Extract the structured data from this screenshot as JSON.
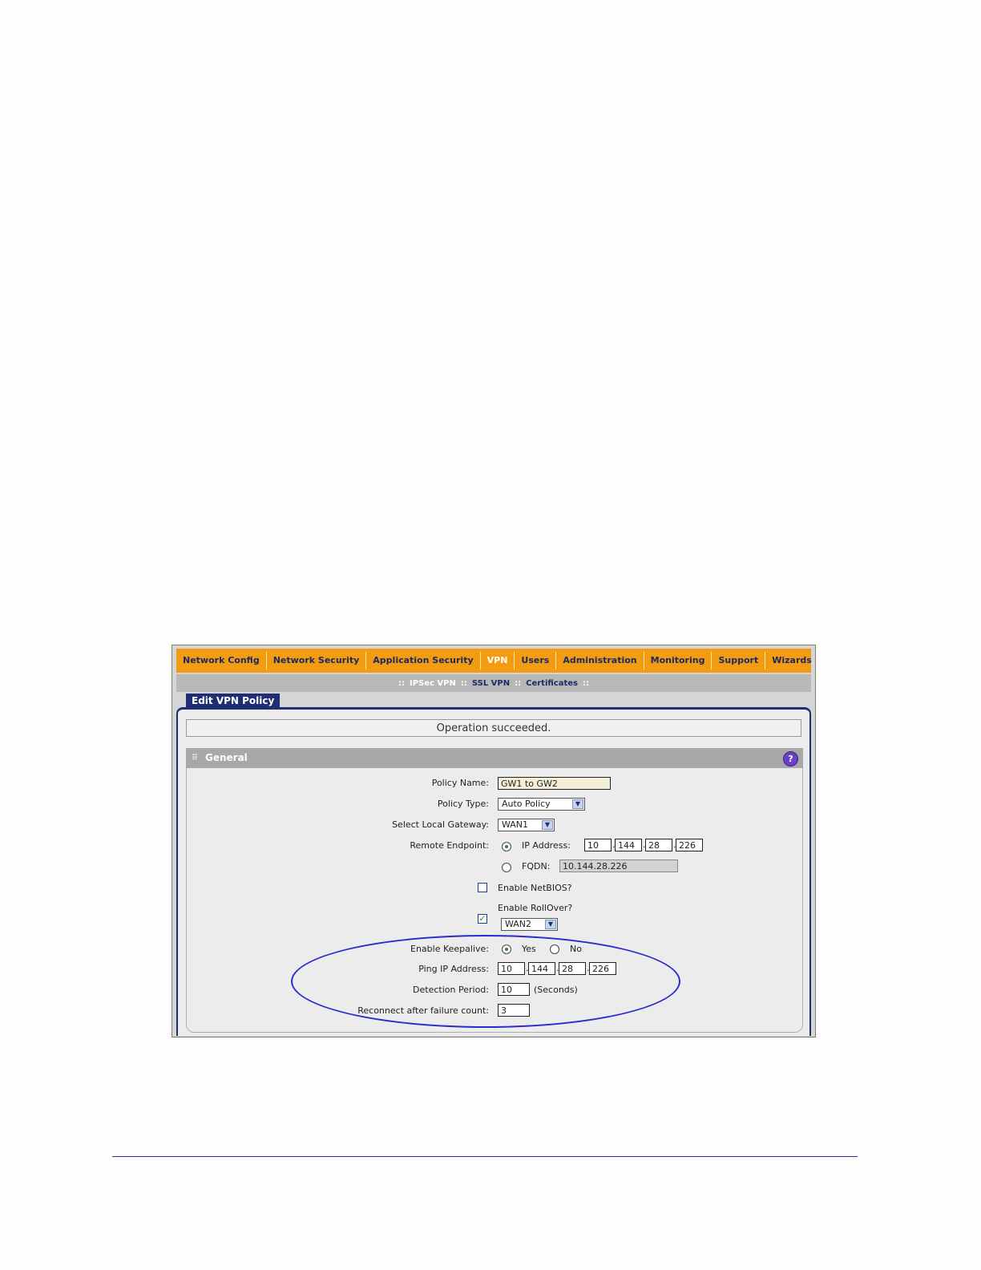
{
  "nav": {
    "items": [
      "Network Config",
      "Network Security",
      "Application Security",
      "VPN",
      "Users",
      "Administration",
      "Monitoring",
      "Support",
      "Wizards"
    ],
    "active": "VPN"
  },
  "subnav": {
    "sep": "::",
    "links": [
      "IPSec VPN",
      "SSL VPN",
      "Certificates"
    ]
  },
  "tab": {
    "label": "Edit VPN Policy"
  },
  "message": "Operation succeeded.",
  "section": {
    "title": "General",
    "grip": "⠿",
    "help": "?"
  },
  "form": {
    "policy_name": {
      "label": "Policy Name:",
      "value": "GW1 to GW2"
    },
    "policy_type": {
      "label": "Policy Type:",
      "value": "Auto Policy"
    },
    "local_gateway": {
      "label": "Select Local Gateway:",
      "value": "WAN1"
    },
    "remote_endpoint": {
      "label": "Remote Endpoint:",
      "ip_label": "IP Address:",
      "ip": [
        "10",
        "144",
        "28",
        "226"
      ],
      "fqdn_label": "FQDN:",
      "fqdn": "10.144.28.226"
    },
    "netbios": {
      "label": "Enable NetBIOS?",
      "checked": false
    },
    "rollover": {
      "label": "Enable RollOver?",
      "checked": true,
      "value": "WAN2",
      "check_mark": "✓"
    },
    "keepalive": {
      "label": "Enable Keepalive:",
      "yes": "Yes",
      "no": "No",
      "selected": "Yes"
    },
    "ping_ip": {
      "label": "Ping IP Address:",
      "ip": [
        "10",
        "144",
        "28",
        "226"
      ]
    },
    "detection_period": {
      "label": "Detection Period:",
      "value": "10",
      "unit": "(Seconds)"
    },
    "reconnect": {
      "label": "Reconnect after failure count:",
      "value": "3"
    },
    "ip_sep": "."
  },
  "icons": {
    "dropdown": "chevron-down-icon",
    "help": "help-icon",
    "grip": "grip-icon"
  },
  "colors": {
    "nav_bg": "#f39c12",
    "tab_bg": "#1f2e73",
    "highlight_ellipse": "#2a2ad0",
    "footer_rule": "#2b2bb0"
  }
}
